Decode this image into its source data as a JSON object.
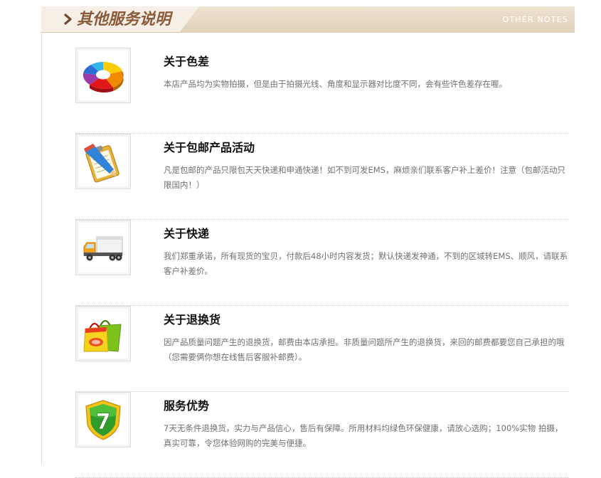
{
  "header": {
    "title": "其他服务说明",
    "note": "OTHER NOTES"
  },
  "items": [
    {
      "icon": "color-wheel-icon",
      "title": "关于色差",
      "desc": "本店产品均为实物拍摄，但是由于拍摄光线、角度和显示器对比度不同，会有些许色差存在喔。"
    },
    {
      "icon": "clipboard-pen-icon",
      "title": "关于包邮产品活动",
      "desc": "凡是包邮的产品只限包天天快递和申通快递！如不到可发EMS，麻烦亲们联系客户补上差价！注意（包邮活动只限国内！）"
    },
    {
      "icon": "delivery-truck-icon",
      "title": "关于快递",
      "desc": "我们郑重承诺，所有现货的宝贝，付款后48小时内容发货；默认快递发神通，不到的区域转EMS、顺风，请联系客户补差价。"
    },
    {
      "icon": "shopping-bags-icon",
      "title": "关于退换货",
      "desc": "因产品质量问题产生的退换货，邮费由本店承担。非质量问题所产生的退换货，来回的邮费都要您自己承担的哦（您需要俩你想在线售后客服补邮费）。"
    },
    {
      "icon": "seven-day-shield-icon",
      "title": "服务优势",
      "desc": "7天无条件退换货，实力与产品信心，售后有保障。所用材料均绿色环保健康，请放心选购；100%实物 拍摄，真实可靠，令您体验网购的完美与便捷。",
      "badge": "7"
    }
  ]
}
